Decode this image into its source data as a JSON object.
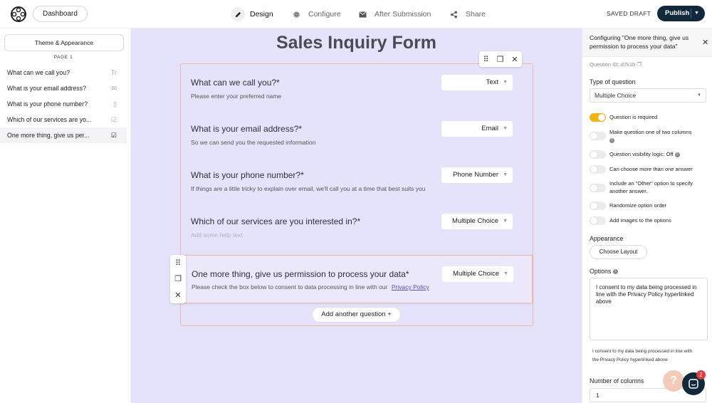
{
  "topbar": {
    "dashboard_label": "Dashboard",
    "nav": [
      {
        "label": "Design",
        "icon": "pencil-icon",
        "active": true
      },
      {
        "label": "Configure",
        "icon": "gear-icon",
        "active": false
      },
      {
        "label": "After Submission",
        "icon": "envelope-icon",
        "active": false
      },
      {
        "label": "Share",
        "icon": "share-icon",
        "active": false
      }
    ],
    "status": "SAVED DRAFT",
    "publish_label": "Publish"
  },
  "sidebar": {
    "theme_label": "Theme & Appearance",
    "page_label": "PAGE 1",
    "items": [
      {
        "label": "What can we call you?",
        "icon": "Tr"
      },
      {
        "label": "What is your email address?",
        "icon": "✉"
      },
      {
        "label": "What is your phone number?",
        "icon": "▯"
      },
      {
        "label": "Which of our services are yo...",
        "icon": "☑"
      },
      {
        "label": "One more thing, give us per...",
        "icon": "☑"
      }
    ]
  },
  "form": {
    "title": "Sales Inquiry Form",
    "questions": [
      {
        "title": "What can we call you?*",
        "help": "Please enter your preferred name",
        "type": "Text"
      },
      {
        "title": "What is your email address?*",
        "help": "So we can send you the requested information",
        "type": "Email"
      },
      {
        "title": "What is your phone number?*",
        "help": "If things are a little tricky to explain over email, we'll call you at a time that best suits you",
        "type": "Phone Number"
      },
      {
        "title": "Which of our services are you interested in?*",
        "help": "Add some help text",
        "type": "Multiple Choice"
      },
      {
        "title": "One more thing, give us permission to process your data*",
        "help": "Please check the box below to consent to data processing in line with our",
        "link": "Privacy Policy",
        "type": "Multiple Choice"
      }
    ],
    "add_question_label": "Add another question +"
  },
  "panel": {
    "header": "Configuring \"One more thing, give us permission to process your data\"",
    "question_id": "Question ID: d7k1b",
    "type_label": "Type of question",
    "type_value": "Multiple Choice",
    "toggles": [
      {
        "label": "Question is required",
        "on": true
      },
      {
        "label": "Make question one of two columns",
        "on": false
      },
      {
        "label": "Question visibility logic: Off",
        "on": false
      },
      {
        "label": "Can choose more than one answer",
        "on": false
      },
      {
        "label": "Include an \"Other\" option to specify another answer.",
        "on": false
      },
      {
        "label": "Randomize option order",
        "on": false
      },
      {
        "label": "Add images to the options",
        "on": false
      }
    ],
    "appearance_label": "Appearance",
    "choose_layout_label": "Choose Layout",
    "options_label": "Options",
    "options_text": "I consent to my data being processed in line with the Privacy Policy hyperlinked above",
    "options_preview": "I consent to my data being processed in line with the Privacy Policy hyperlinked above",
    "num_columns_label": "Number of columns",
    "num_columns_value": "1"
  },
  "chat": {
    "badge": "2"
  },
  "colors": {
    "accent": "#f4b30e",
    "dark": "#12283b",
    "canvas": "#e5e3fb",
    "frame": "#f2b9a9"
  }
}
